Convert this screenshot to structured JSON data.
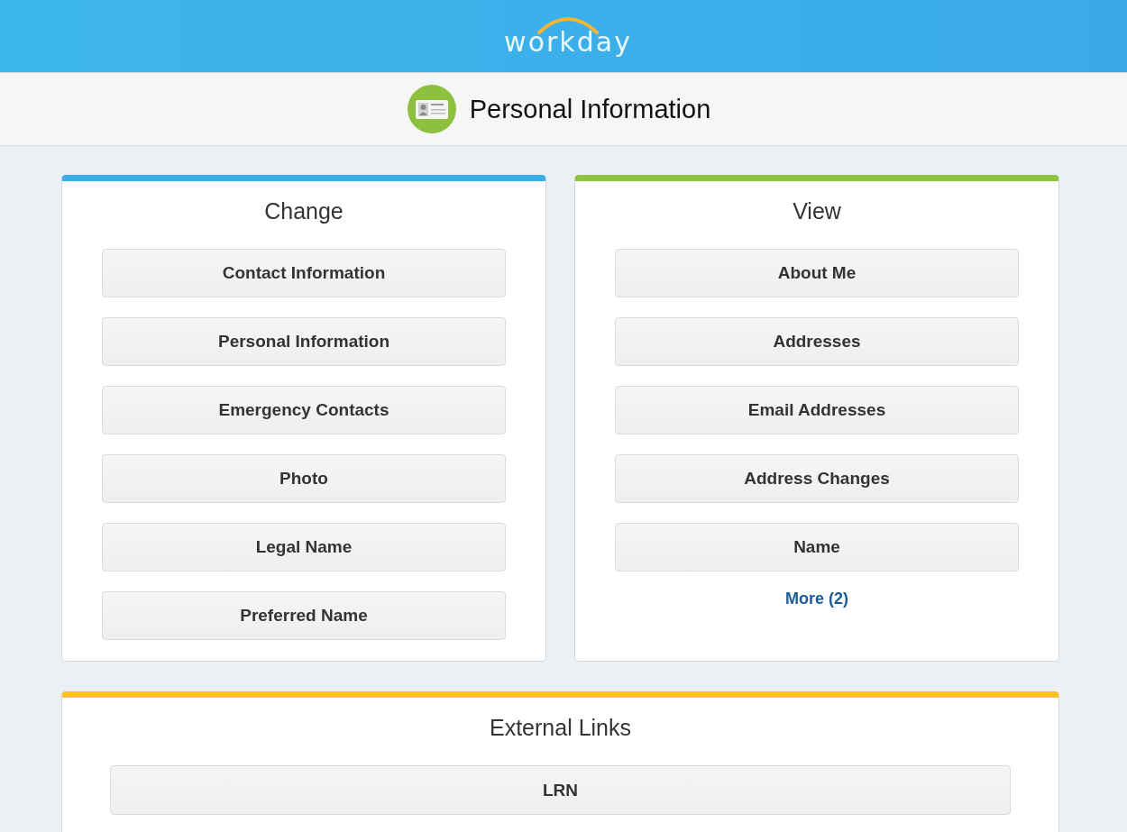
{
  "header": {
    "logo": "workday"
  },
  "page_title": {
    "title": "Personal Information"
  },
  "panels": [
    {
      "title": "Change",
      "color": "#3aaee8",
      "buttons": [
        "Contact Information",
        "Personal Information",
        "Emergency Contacts",
        "Photo",
        "Legal Name",
        "Preferred Name"
      ]
    },
    {
      "title": "View",
      "color": "#8cc63f",
      "buttons": [
        "About Me",
        "Addresses",
        "Email Addresses",
        "Address Changes",
        "Name"
      ],
      "more_link": "More (2)"
    },
    {
      "title": "External Links",
      "color": "#fbc02d",
      "buttons": [
        "LRN"
      ]
    }
  ]
}
